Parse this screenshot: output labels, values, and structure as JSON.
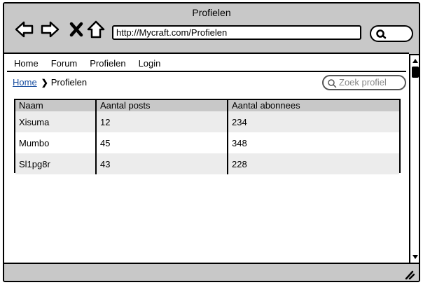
{
  "window": {
    "title": "Profielen"
  },
  "toolbar": {
    "back_icon": "back-arrow-icon",
    "forward_icon": "forward-arrow-icon",
    "stop_icon": "stop-x-icon",
    "home_icon": "home-icon",
    "url": "http://Mycraft.com/Profielen",
    "search_icon": "search-icon"
  },
  "menu": {
    "items": [
      {
        "label": "Home"
      },
      {
        "label": "Forum"
      },
      {
        "label": "Profielen"
      },
      {
        "label": "Login"
      }
    ]
  },
  "breadcrumb": {
    "home": "Home",
    "separator": "❯",
    "current": "Profielen"
  },
  "profile_search": {
    "placeholder": "Zoek profiel"
  },
  "table": {
    "headers": [
      "Naam",
      "Aantal posts",
      "Aantal abonnees"
    ],
    "rows": [
      [
        "Xisuma",
        "12",
        "234"
      ],
      [
        "Mumbo",
        "45",
        "348"
      ],
      [
        "Sl1pg8r",
        "43",
        "228"
      ]
    ]
  },
  "colors": {
    "chrome": "#c8c8c8",
    "link": "#1a4fa0",
    "row_alt": "#ececec"
  }
}
